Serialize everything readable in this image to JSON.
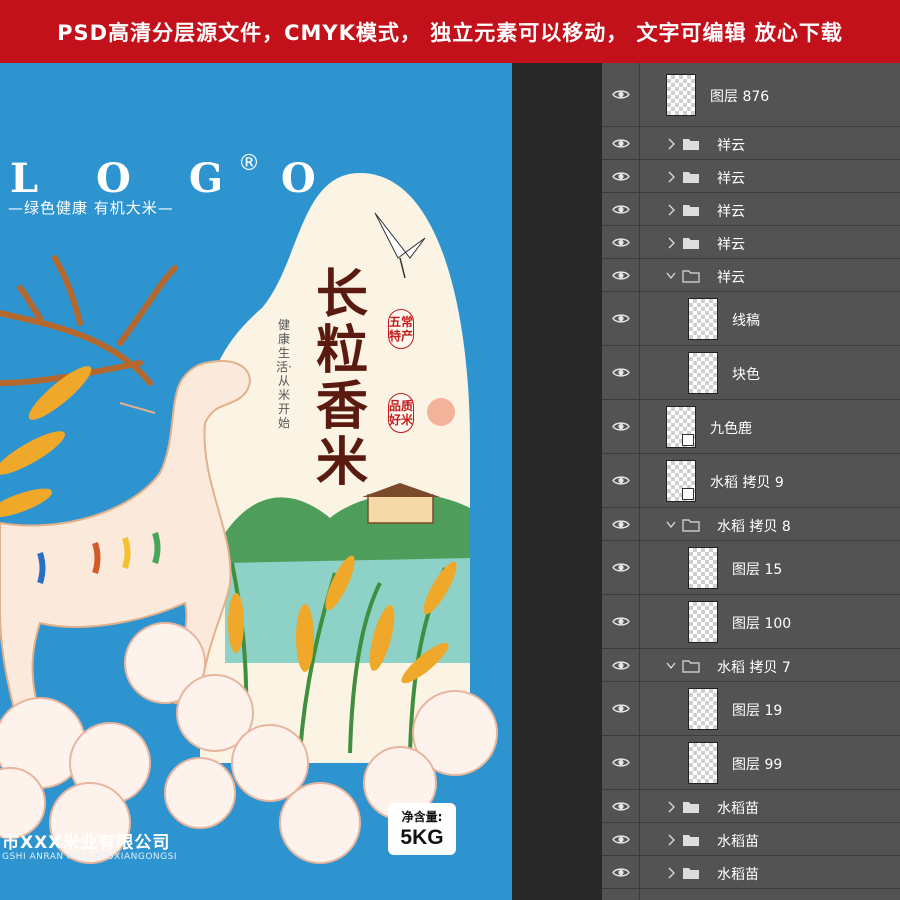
{
  "banner": {
    "text": "PSD高清分层源文件，CMYK模式， 独立元素可以移动， 文字可编辑 放心下载"
  },
  "artwork": {
    "logo": "L O G O",
    "registered": "®",
    "slogan": "—绿色健康 有机大米—",
    "title_chars": [
      "长",
      "粒",
      "香",
      "米"
    ],
    "side_slogan": "健康生活·从米开始",
    "seal_1": "五常特产",
    "seal_2": "品质好米",
    "company": "市XXX米业有限公司",
    "company_pinyin": "GSHI ANRAN MIYE YOUXIANGONGSI",
    "net_label": "净含量:",
    "net_value": "5KG"
  },
  "colors": {
    "banner_bg": "#c2111a",
    "canvas_bg": "#2e94cf",
    "panel_bg": "#535353",
    "title": "#5a1a10",
    "seal": "#c41c1c"
  },
  "layers": [
    {
      "name": "图层 876",
      "type": "layer",
      "expanded": false,
      "indent": 0,
      "linked": false
    },
    {
      "name": "祥云",
      "type": "group",
      "expanded": false,
      "indent": 0
    },
    {
      "name": "祥云",
      "type": "group",
      "expanded": false,
      "indent": 0
    },
    {
      "name": "祥云",
      "type": "group",
      "expanded": false,
      "indent": 0
    },
    {
      "name": "祥云",
      "type": "group",
      "expanded": false,
      "indent": 0
    },
    {
      "name": "祥云",
      "type": "group",
      "expanded": true,
      "indent": 0
    },
    {
      "name": "线稿",
      "type": "layer",
      "indent": 1,
      "linked": false
    },
    {
      "name": "块色",
      "type": "layer",
      "indent": 1,
      "linked": false
    },
    {
      "name": "九色鹿",
      "type": "layer",
      "indent": 0,
      "linked": true
    },
    {
      "name": "水稻 拷贝 9",
      "type": "layer",
      "indent": 0,
      "linked": true
    },
    {
      "name": "水稻 拷贝 8",
      "type": "group",
      "expanded": true,
      "indent": 0
    },
    {
      "name": "图层 15",
      "type": "layer",
      "indent": 1,
      "linked": false
    },
    {
      "name": "图层 100",
      "type": "layer",
      "indent": 1,
      "linked": false
    },
    {
      "name": "水稻 拷贝 7",
      "type": "group",
      "expanded": true,
      "indent": 0
    },
    {
      "name": "图层 19",
      "type": "layer",
      "indent": 1,
      "linked": false
    },
    {
      "name": "图层 99",
      "type": "layer",
      "indent": 1,
      "linked": false
    },
    {
      "name": "水稻苗",
      "type": "group",
      "expanded": false,
      "indent": 0
    },
    {
      "name": "水稻苗",
      "type": "group",
      "expanded": false,
      "indent": 0
    },
    {
      "name": "水稻苗",
      "type": "group",
      "expanded": false,
      "indent": 0
    },
    {
      "name": "水稻苗",
      "type": "group",
      "expanded": false,
      "indent": 0
    }
  ]
}
